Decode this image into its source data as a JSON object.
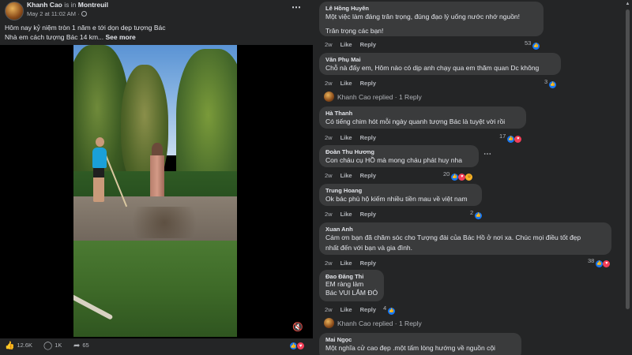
{
  "post": {
    "author": "Khanh Cao",
    "is_in": "is in",
    "place": "Montreuil",
    "timestamp": "May 2 at 11:02 AM",
    "caption_line1": "Hôm nay kỷ niệm tròn 1 năm e tới dọn dẹp tượng Bác",
    "caption_line2": "Nhà em cách tượng Bác 14 km...",
    "see_more": "See more",
    "more_icon": "⋯",
    "mute_icon": "🔇",
    "stats": {
      "likes": "12.6K",
      "comments": "1K",
      "shares": "65"
    }
  },
  "comments": [
    {
      "author": "Lê Hồng Huyên",
      "lines": [
        "Một việc làm đáng trân trọng, đúng đạo lý uống nước nhớ nguồn!",
        "",
        "Trân trọng các bạn!"
      ],
      "time": "2w",
      "like": "Like",
      "reply": "Reply",
      "reactions": "53"
    },
    {
      "author": "Văn Phụ Mai",
      "lines": [
        "Chỗ nà đấy em, Hôm nào có dịp anh chạy qua em thăm quan Dc không"
      ],
      "time": "2w",
      "like": "Like",
      "reply": "Reply",
      "reactions": "3"
    },
    {
      "author": "Hà Thanh",
      "lines": [
        "Có tiếng chim hót mỗi ngày quanh tượng Bác là tuyệt vời rồi"
      ],
      "time": "2w",
      "like": "Like",
      "reply": "Reply",
      "reactions": "17"
    },
    {
      "author": "Đoàn Thu Hương",
      "lines": [
        "Con cháu cụ HỒ mà mong cháu phát huy nha"
      ],
      "time": "2w",
      "like": "Like",
      "reply": "Reply",
      "reactions": "20"
    },
    {
      "author": "Trung Hoang",
      "lines": [
        "Ok bác phù hộ kiếm nhiều tiền mau về việt nam"
      ],
      "time": "2w",
      "like": "Like",
      "reply": "Reply",
      "reactions": "2"
    },
    {
      "author": "Xuan Anh",
      "lines": [
        "Cám ơn bạn đã chăm sóc cho Tượng đài của Bác Hồ ở nơi xa. Chúc mọi điều tốt đẹp",
        "nhất đến với bạn và gia đình."
      ],
      "time": "2w",
      "like": "Like",
      "reply": "Reply",
      "reactions": "38"
    },
    {
      "author": "Đao Đăng Thi",
      "lines": [
        "EM ràng làm",
        "Bác VUI LẮM ĐÓ"
      ],
      "time": "2w",
      "like": "Like",
      "reply": "Reply",
      "reactions": "4"
    },
    {
      "author": "Mai Ngọc",
      "lines": [
        "Một nghĩa cử cao đẹp .một tấm lòng hướng về nguồn cội"
      ]
    }
  ],
  "replies": [
    {
      "text": "Khanh Cao replied · 1 Reply"
    },
    {
      "text": "Khanh Cao replied · 1 Reply"
    }
  ],
  "colors": {
    "background": "#18191a",
    "panel": "#242526",
    "bubble": "#3a3b3c",
    "like_blue": "#1877f2",
    "love_red": "#f33e58"
  }
}
